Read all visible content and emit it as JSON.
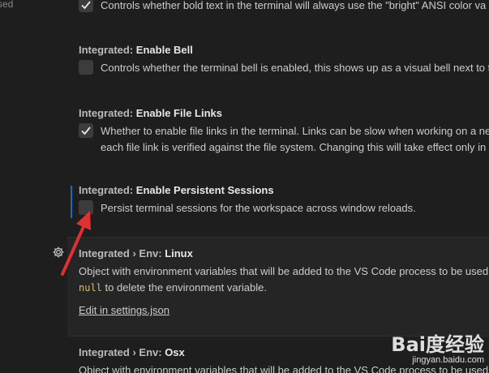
{
  "nav": {
    "fragment": "sed"
  },
  "settings": {
    "bold_bright": {
      "description": "Controls whether bold text in the terminal will always use the \"bright\" ANSI color va",
      "checked": true
    },
    "enable_bell": {
      "category": "Integrated: ",
      "name": "Enable Bell",
      "description": "Controls whether the terminal bell is enabled, this shows up as a visual bell next to t",
      "checked": false
    },
    "enable_file_links": {
      "category": "Integrated: ",
      "name": "Enable File Links",
      "description_line1": "Whether to enable file links in the terminal. Links can be slow when working on a ne",
      "description_line2": "each file link is verified against the file system. Changing this will take effect only in n",
      "checked": true
    },
    "enable_persistent_sessions": {
      "category": "Integrated: ",
      "name": "Enable Persistent Sessions",
      "description": "Persist terminal sessions for the workspace across window reloads.",
      "checked": false
    },
    "env_linux": {
      "category": "Integrated › Env: ",
      "name": "Linux",
      "description_line1": "Object with environment variables that will be added to the VS Code process to be used",
      "null_token": "null",
      "description_line2_rest": " to delete the environment variable.",
      "edit_link": "Edit in settings.json"
    },
    "env_osx": {
      "category": "Integrated › Env: ",
      "name": "Osx",
      "description": "Object with environment variables that will be added to the VS Code process to be used"
    }
  },
  "icons": {
    "gear": "gear-icon",
    "check": "check-icon",
    "arrow": "red-arrow-annotation"
  },
  "colors": {
    "focus_bar": "#0e71c0",
    "arrow": "#e0302f",
    "background": "#1e1e1e"
  },
  "watermark": {
    "logo": "Bai度经验",
    "url": "jingyan.baidu.com"
  }
}
